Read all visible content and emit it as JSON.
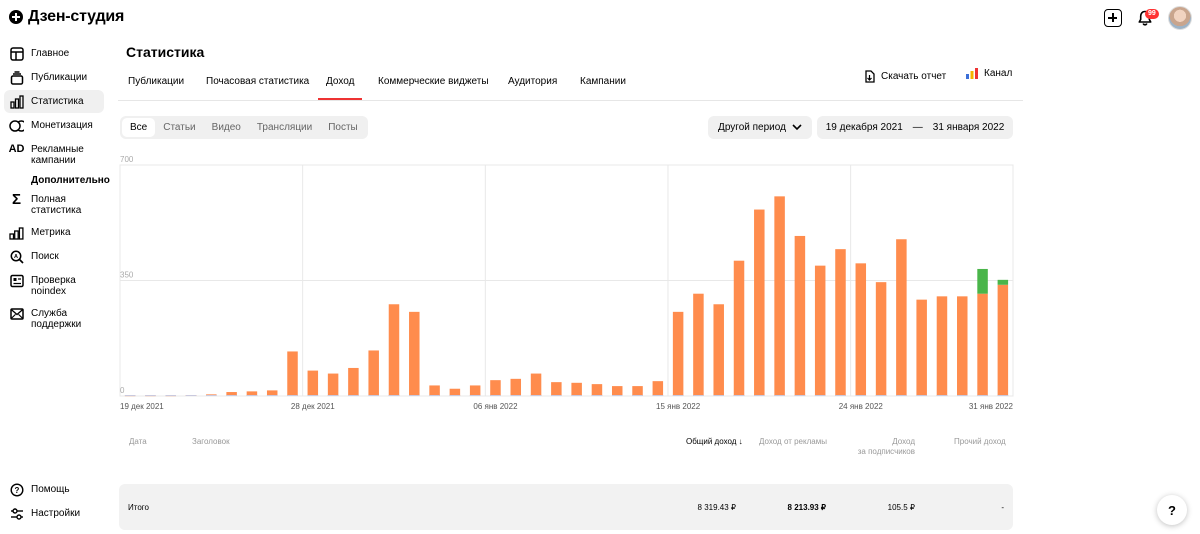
{
  "app": {
    "title": "Дзен-студия"
  },
  "header": {
    "notifications_badge": "99"
  },
  "sidebar": {
    "items": [
      {
        "label": "Главное",
        "icon": "layout-icon"
      },
      {
        "label": "Публикации",
        "icon": "stack-icon"
      },
      {
        "label": "Статистика",
        "icon": "bar-chart-icon",
        "active": true
      },
      {
        "label": "Монетизация",
        "icon": "coins-icon"
      },
      {
        "label": "Рекламные кампании",
        "icon": "ad-icon"
      }
    ],
    "section": "Дополнительно",
    "extra": [
      {
        "label": "Полная статистика",
        "icon": "sigma-icon"
      },
      {
        "label": "Метрика",
        "icon": "metrics-icon"
      },
      {
        "label": "Поиск",
        "icon": "search-icon"
      },
      {
        "label": "Проверка noindex",
        "icon": "check-icon"
      },
      {
        "label": "Служба поддержки",
        "icon": "mail-icon"
      }
    ],
    "bottom": [
      {
        "label": "Помощь",
        "icon": "help-icon"
      },
      {
        "label": "Настройки",
        "icon": "sliders-icon"
      }
    ]
  },
  "page": {
    "title": "Статистика"
  },
  "tabs": [
    "Публикации",
    "Почасовая статистика",
    "Доход",
    "Коммерческие виджеты",
    "Аудитория",
    "Кампании"
  ],
  "active_tab": "Доход",
  "actions": {
    "download": "Скачать отчет",
    "channel": "Канал"
  },
  "filters": [
    "Все",
    "Статьи",
    "Видео",
    "Трансляции",
    "Посты"
  ],
  "period": {
    "label": "Другой период",
    "from": "19 декабря 2021",
    "sep": "—",
    "to": "31 января 2022"
  },
  "chart_data": {
    "type": "bar",
    "stacked": true,
    "y_ticks": [
      "700",
      "350",
      "0"
    ],
    "ylim": [
      0,
      700
    ],
    "x_tick_labels": [
      "19 дек 2021",
      "28 дек 2021",
      "06 янв 2022",
      "15 янв 2022",
      "24 янв 2022",
      "31 янв 2022"
    ],
    "categories": [
      "19.12",
      "20.12",
      "21.12",
      "22.12",
      "23.12",
      "24.12",
      "25.12",
      "26.12",
      "27.12",
      "28.12",
      "29.12",
      "30.12",
      "31.12",
      "01.01",
      "02.01",
      "03.01",
      "04.01",
      "05.01",
      "06.01",
      "07.01",
      "08.01",
      "09.01",
      "10.01",
      "11.01",
      "12.01",
      "13.01",
      "14.01",
      "15.01",
      "16.01",
      "17.01",
      "18.01",
      "19.01",
      "20.01",
      "21.01",
      "22.01",
      "23.01",
      "24.01",
      "25.01",
      "26.01",
      "27.01",
      "28.01",
      "29.01",
      "30.01",
      "31.01"
    ],
    "series": [
      {
        "values": [
          2,
          2,
          2,
          3,
          5,
          12,
          14,
          17,
          135,
          77,
          68,
          85,
          138,
          278,
          255,
          32,
          22,
          32,
          48,
          52,
          68,
          42,
          40,
          36,
          30,
          30,
          45,
          255,
          310,
          278,
          410,
          565,
          605,
          485,
          395,
          445,
          402,
          345,
          475,
          292,
          302,
          302,
          310,
          337
        ],
        "color": "#ff8c4d"
      },
      {
        "values": [
          0,
          0,
          0,
          0,
          0,
          0,
          0,
          0,
          0,
          0,
          0,
          0,
          0,
          0,
          0,
          0,
          0,
          0,
          0,
          0,
          0,
          0,
          0,
          0,
          0,
          0,
          0,
          0,
          0,
          0,
          0,
          0,
          0,
          0,
          0,
          0,
          0,
          0,
          0,
          0,
          0,
          0,
          75,
          15
        ],
        "color": "#4ab54a"
      }
    ],
    "grid": true
  },
  "table": {
    "headers": {
      "date": "Дата",
      "title": "Заголовок",
      "total": "Общий доход ↓",
      "ads": "Доход от рекламы",
      "subs_1": "Доход",
      "subs_2": "за подписчиков",
      "other": "Прочий доход"
    },
    "totals": {
      "label": "Итого",
      "total": "8 319.43 ₽",
      "ads": "8 213.93 ₽",
      "subs": "105.5 ₽",
      "other": "-"
    }
  },
  "help_float": "?"
}
